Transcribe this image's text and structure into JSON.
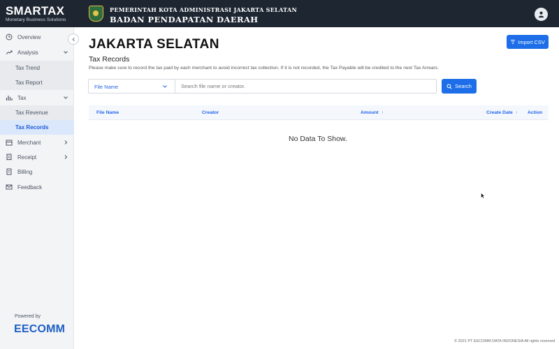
{
  "brand": {
    "name": "SMARTAX",
    "tagline": "Monetary Business Solutions"
  },
  "header": {
    "gov_line1": "PEMERINTAH KOTA ADMINISTRASI JAKARTA SELATAN",
    "gov_line2": "BADAN PENDAPATAN DAERAH"
  },
  "sidebar": {
    "items": [
      {
        "label": "Overview",
        "icon": "clock-icon"
      },
      {
        "label": "Analysis",
        "icon": "trend-icon",
        "expanded": true,
        "children": [
          {
            "label": "Tax Trend"
          },
          {
            "label": "Tax Report"
          }
        ]
      },
      {
        "label": "Tax",
        "icon": "bar-chart-icon",
        "expanded": true,
        "children": [
          {
            "label": "Tax Revenue"
          },
          {
            "label": "Tax Records",
            "active": true
          }
        ]
      },
      {
        "label": "Merchant",
        "icon": "store-icon"
      },
      {
        "label": "Receipt",
        "icon": "receipt-icon"
      },
      {
        "label": "Billing",
        "icon": "billing-icon"
      },
      {
        "label": "Feedback",
        "icon": "mail-icon"
      }
    ],
    "powered_by": "Powered by",
    "partner": "EECOMM"
  },
  "main": {
    "page_title": "JAKARTA SELATAN",
    "import_label": "Import CSV",
    "section_title": "Tax Records",
    "section_desc": "Please make sure to record the tax paid by each merchant to avoid incorrect tax collection. If it is not recorded, the Tax Payable will be credited to the next Tax Arrears.",
    "filter": {
      "selected": "File Name",
      "placeholder": "Search file name or creator.",
      "value": ""
    },
    "search_label": "Search",
    "table": {
      "columns": [
        "File Name",
        "Creator",
        "Amount",
        "Create Date",
        "Action"
      ],
      "rows": [],
      "empty_text": "No Data To Show."
    }
  },
  "footer": "© 2021 PT EECOMM DATA INDONESIA All rights reserved",
  "colors": {
    "accent": "#1d6ee8",
    "topbar": "#1d2631",
    "active_bg": "#dbe8fb"
  }
}
